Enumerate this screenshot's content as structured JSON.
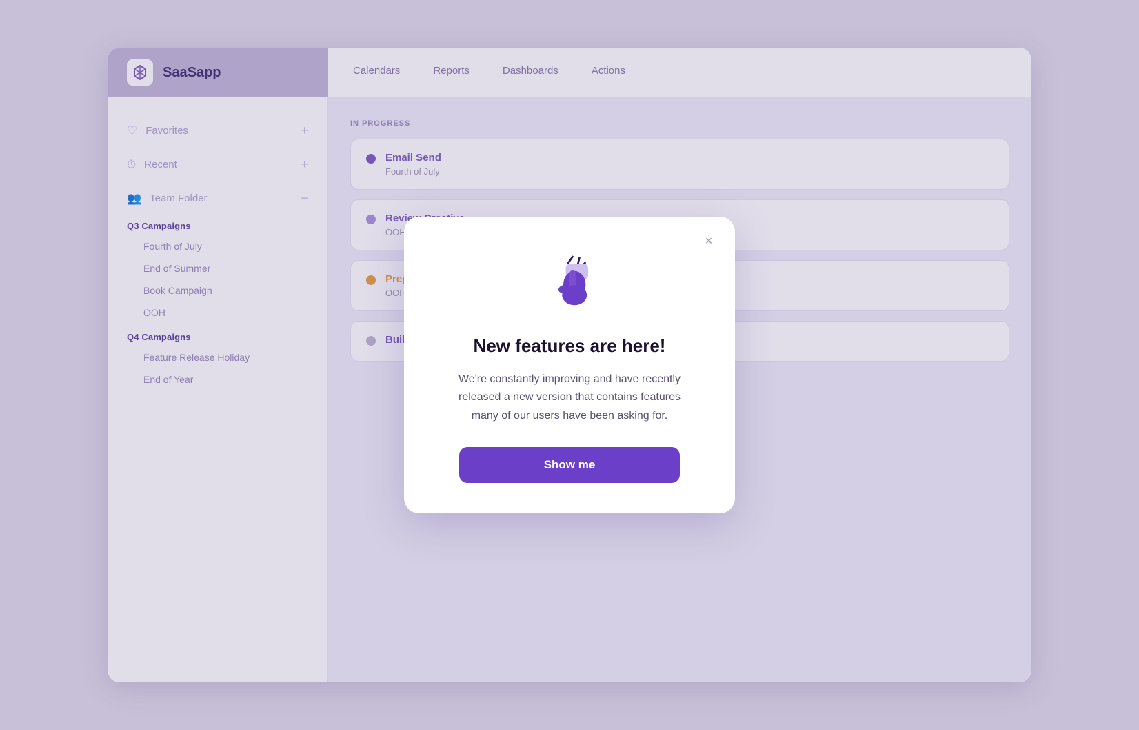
{
  "app": {
    "logo_label": "SaaSapp",
    "logo_icon": "⬡"
  },
  "nav": {
    "items": [
      {
        "label": "Calendars"
      },
      {
        "label": "Reports"
      },
      {
        "label": "Dashboards"
      },
      {
        "label": "Actions"
      }
    ]
  },
  "sidebar": {
    "sections": [
      {
        "icon": "♡",
        "label": "Favorites",
        "action": "+"
      },
      {
        "icon": "⏱",
        "label": "Recent",
        "action": "+"
      },
      {
        "icon": "👥",
        "label": "Team Folder",
        "action": "−",
        "groups": [
          {
            "label": "Q3 Campaigns",
            "items": [
              "Fourth of July",
              "End of Summer",
              "Book Campaign",
              "OOH"
            ]
          },
          {
            "label": "Q4 Campaigns",
            "items": [
              "Feature Release Holiday",
              "End of Year"
            ]
          }
        ]
      }
    ]
  },
  "main": {
    "section_label": "IN PROGRESS",
    "tasks": [
      {
        "dot_color": "purple",
        "title": "Email Send",
        "subtitle": "Fourth of July"
      },
      {
        "dot_color": "light-purple",
        "title": "Review Creative",
        "subtitle": "OOH"
      },
      {
        "dot_color": "orange",
        "title": "Prepare Advertising",
        "subtitle": "OOH"
      },
      {
        "dot_color": "gray",
        "title": "Build Landing Page",
        "subtitle": ""
      }
    ]
  },
  "modal": {
    "close_label": "×",
    "title": "New features are here!",
    "body": "We're constantly improving and have recently released a new version that contains features many of our users have been asking for.",
    "cta_label": "Show me"
  }
}
